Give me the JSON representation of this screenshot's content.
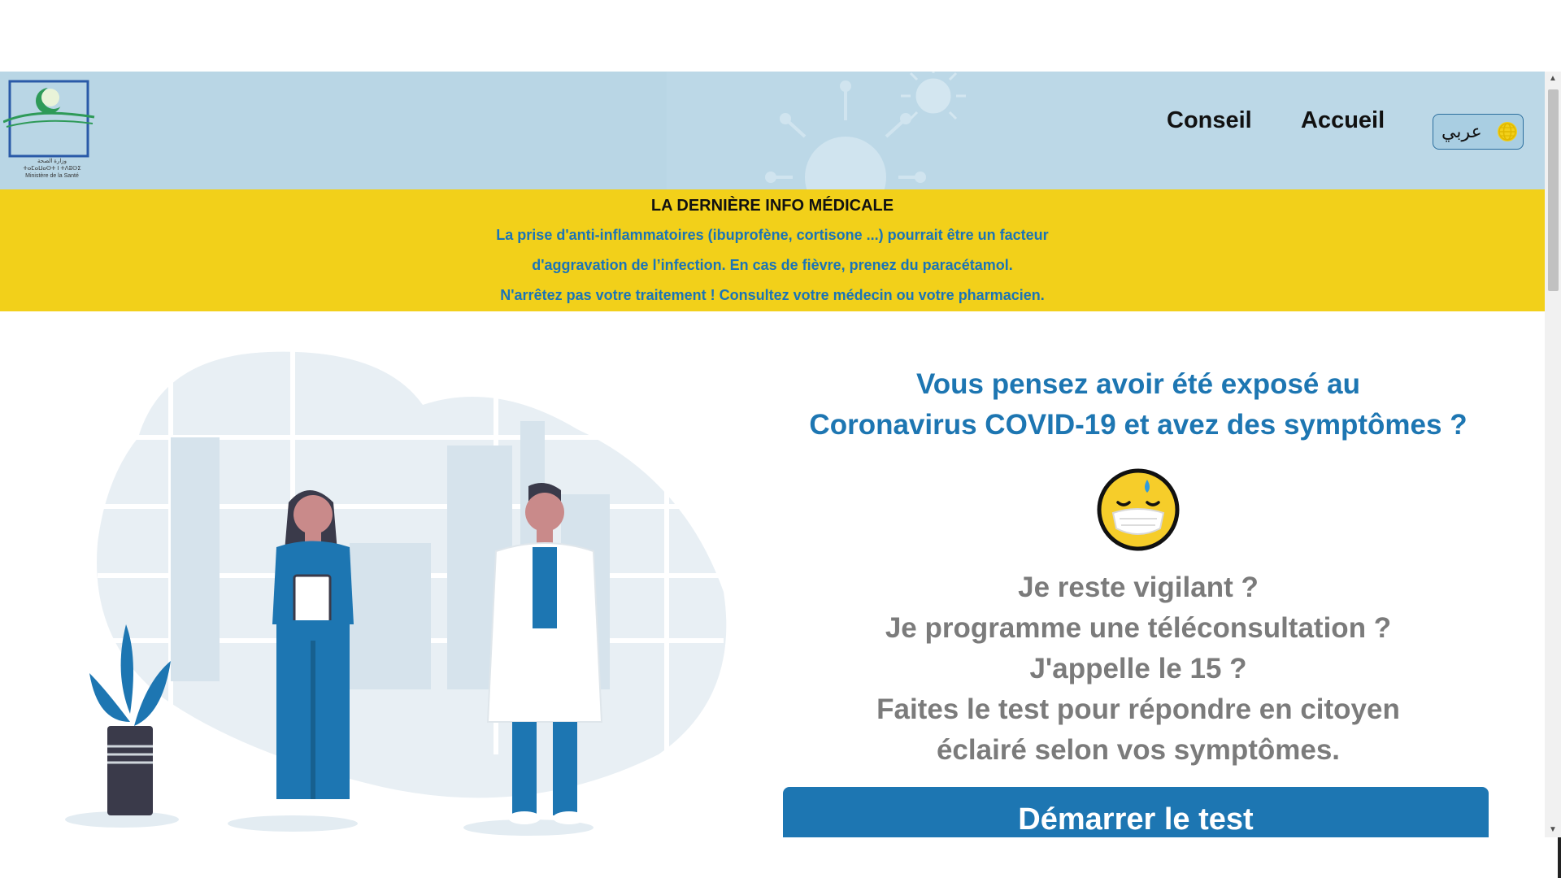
{
  "logo": {
    "caption_line1": "وزارة الصحة",
    "caption_line2": "ⵜⴰⵎⴰⵡⴰⵙⵜ ⵏ ⵜⴷⵓⵙⵉ",
    "caption_line3": "Ministère de la Santé"
  },
  "nav": {
    "conseil": "Conseil",
    "accueil": "Accueil",
    "language_toggle": "عربي"
  },
  "banner": {
    "title": "LA DERNIÈRE INFO MÉDICALE",
    "line1": "La prise d'anti-inflammatoires (ibuprofène, cortisone ...) pourrait être un facteur",
    "line2": "d'aggravation de l’infection. En cas de fièvre, prenez du paracétamol.",
    "line3": "N'arrêtez pas votre traitement ! Consultez votre médecin ou votre pharmacien."
  },
  "hero": {
    "title_line1": "Vous pensez avoir été exposé au",
    "title_line2": "Coronavirus COVID-19 et avez des symptômes ?",
    "q1": "Je reste vigilant ?",
    "q2": "Je programme une téléconsultation ?",
    "q3": "J'appelle le 15 ?",
    "q4": "Faites le test pour répondre en citoyen",
    "q5": "éclairé selon vos symptômes.",
    "start_button": "Démarrer le test"
  },
  "colors": {
    "header_bg": "#b9d6e5",
    "banner_bg": "#f2d01a",
    "accent_blue": "#1d76b2",
    "question_gray": "#7b7b7b"
  }
}
